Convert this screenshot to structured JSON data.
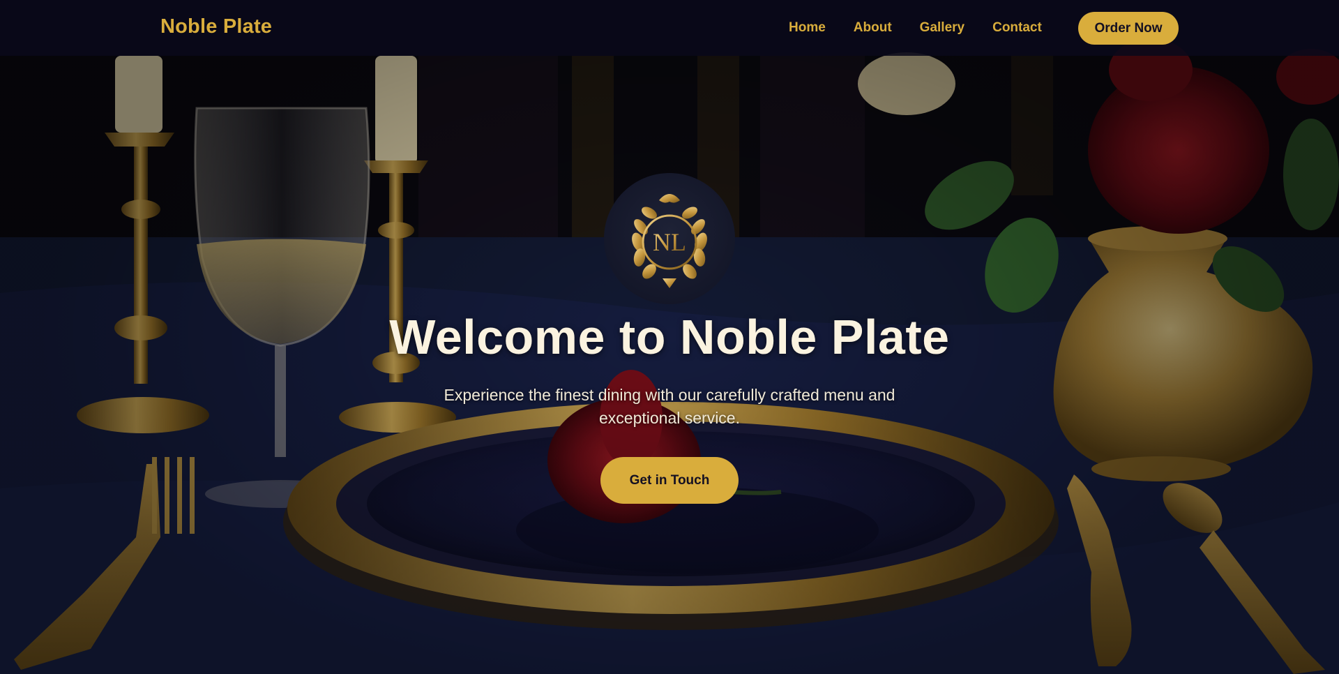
{
  "navbar": {
    "brand": "Noble Plate",
    "links": [
      "Home",
      "About",
      "Gallery",
      "Contact"
    ],
    "order_label": "Order Now"
  },
  "hero": {
    "emblem_icon": "noble-plate-crest-icon",
    "title": "Welcome to Noble Plate",
    "subtitle_line1": "Experience the finest dining with our carefully crafted menu and",
    "subtitle_line2": "exceptional service.",
    "cta_label": "Get in Touch"
  },
  "colors": {
    "accent_gold": "#d9ad3c",
    "nav_background": "#0a091a",
    "title_text": "#fbf3e0",
    "tablecloth_navy": "#17203f"
  }
}
